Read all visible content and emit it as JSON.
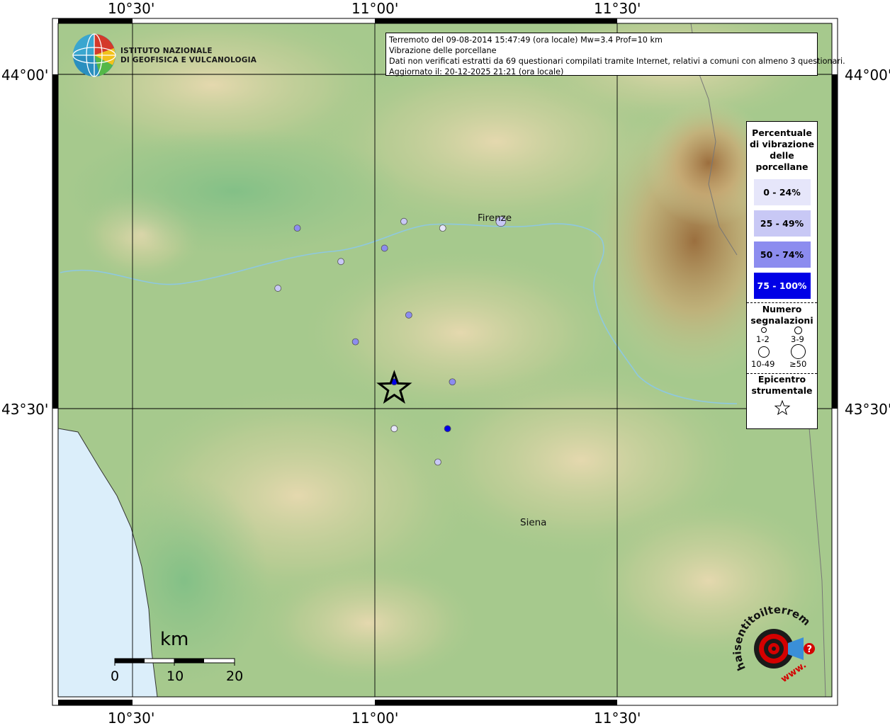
{
  "map": {
    "longitude_labels": [
      "10°30'",
      "11°00'",
      "11°30'"
    ],
    "latitude_labels": [
      "44°00'",
      "43°30'"
    ],
    "info_lines": [
      "Terremoto del 09-08-2014 15:47:49 (ora locale) Mw=3.4 Prof=10 km",
      "Vibrazione delle porcellane",
      "Dati non verificati estratti da 69 questionari compilati tramite Internet, relativi a comuni con almeno 3 questionari.",
      "Aggiornato il: 20-12-2025 21:21 (ora locale)"
    ],
    "cities": [
      "Firenze",
      "Siena"
    ],
    "scale": {
      "unit": "km",
      "ticks": [
        "0",
        "10",
        "20"
      ]
    }
  },
  "logo": {
    "name_line1": "ISTITUTO NAZIONALE",
    "name_line2": "DI GEOFISICA E VULCANOLOGIA"
  },
  "legend": {
    "title": [
      "Percentuale",
      "di vibrazione",
      "delle",
      "porcellane"
    ],
    "classes": [
      {
        "label": "0 - 24%",
        "color": "#e6e6fa",
        "text_color": "#000000"
      },
      {
        "label": "25 - 49%",
        "color": "#c8c8f5",
        "text_color": "#000000"
      },
      {
        "label": "50 - 74%",
        "color": "#8c8cef",
        "text_color": "#000000"
      },
      {
        "label": "75 - 100%",
        "color": "#0000e6",
        "text_color": "#ffffff"
      }
    ],
    "count_title": [
      "Numero",
      "segnalazioni"
    ],
    "count_sizes": [
      "1-2",
      "3-9",
      "10-49",
      "≥50"
    ],
    "epicenter_title": [
      "Epicentro",
      "strumentale"
    ]
  },
  "points": [
    {
      "lon": 10.84,
      "lat": 43.77,
      "cls": 2,
      "size": 1
    },
    {
      "lon": 11.06,
      "lat": 43.78,
      "cls": 1,
      "size": 1
    },
    {
      "lon": 11.14,
      "lat": 43.77,
      "cls": 0,
      "size": 1
    },
    {
      "lon": 11.26,
      "lat": 43.78,
      "cls": 1,
      "size": 2
    },
    {
      "lon": 10.93,
      "lat": 43.72,
      "cls": 1,
      "size": 1
    },
    {
      "lon": 11.02,
      "lat": 43.74,
      "cls": 2,
      "size": 1
    },
    {
      "lon": 10.8,
      "lat": 43.68,
      "cls": 1,
      "size": 1
    },
    {
      "lon": 11.07,
      "lat": 43.64,
      "cls": 2,
      "size": 1
    },
    {
      "lon": 10.96,
      "lat": 43.6,
      "cls": 2,
      "size": 1
    },
    {
      "lon": 11.04,
      "lat": 43.54,
      "cls": 3,
      "size": 1
    },
    {
      "lon": 11.16,
      "lat": 43.54,
      "cls": 2,
      "size": 1
    },
    {
      "lon": 11.04,
      "lat": 43.47,
      "cls": 0,
      "size": 1
    },
    {
      "lon": 11.15,
      "lat": 43.47,
      "cls": 3,
      "size": 1
    },
    {
      "lon": 11.13,
      "lat": 43.42,
      "cls": 1,
      "size": 1
    }
  ],
  "epicenter": {
    "lon": 11.04,
    "lat": 43.53
  },
  "hsi_logo": {
    "text": "haisentitoilterremoto.it",
    "www": "www.",
    "accent": "#d40000"
  }
}
